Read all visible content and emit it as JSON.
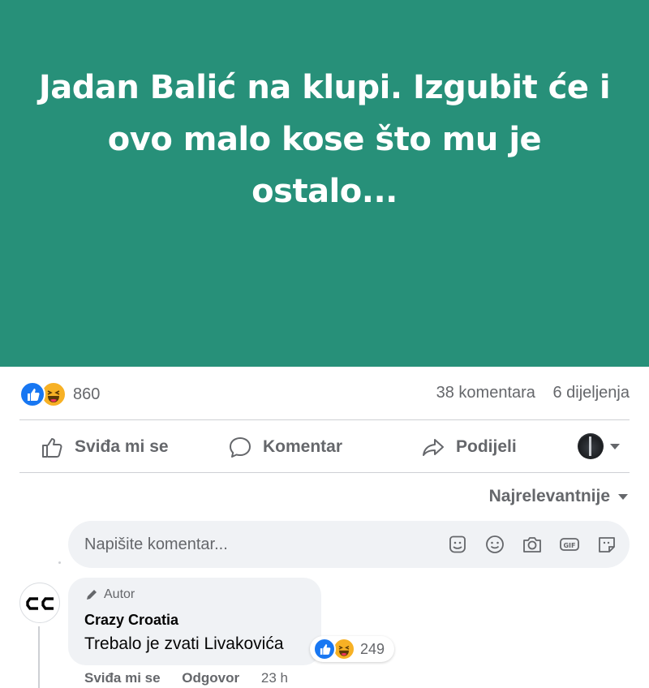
{
  "post": {
    "banner_text": "Jadan Balić na klupi. Izgubit će i ovo malo kose što mu je ostalo...",
    "banner_color": "#279079"
  },
  "stats": {
    "reactions": [
      "like",
      "haha"
    ],
    "reaction_count": "860",
    "comments": "38 komentara",
    "shares": "6 dijeljenja"
  },
  "actions": {
    "like": "Sviđa mi se",
    "comment": "Komentar",
    "share": "Podijeli"
  },
  "sort": {
    "label": "Najrelevantnije"
  },
  "composer": {
    "placeholder": "Napišite komentar...",
    "icons": [
      "avatar-sticker-icon",
      "emoji-icon",
      "camera-icon",
      "gif-icon",
      "sticker-icon"
    ]
  },
  "comment": {
    "author_badge": "Autor",
    "name": "Crazy Croatia",
    "text": "Trebalo je zvati Livakovića",
    "reaction_count": "249",
    "like_label": "Sviđa mi se",
    "reply_label": "Odgovor",
    "time": "23 h"
  },
  "colors": {
    "accent": "#1877f2",
    "haha": "#f7b125",
    "muted_text": "#65676b"
  }
}
